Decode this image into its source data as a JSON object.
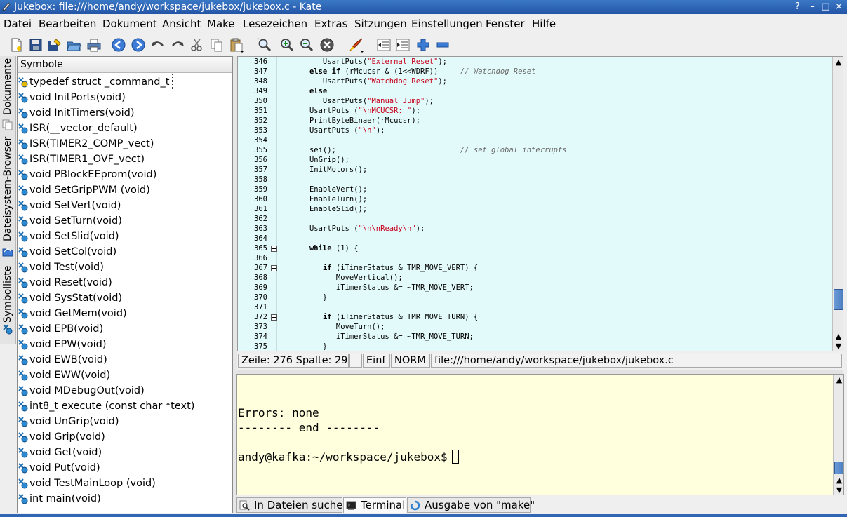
{
  "window": {
    "title": "Jukebox: file:///home/andy/workspace/jukebox/jukebox.c - Kate",
    "controls": {
      "help": "?",
      "minimize": "–",
      "maximize": "□",
      "close": "×"
    }
  },
  "menubar": [
    "Datei",
    "Bearbeiten",
    "Dokument",
    "Ansicht",
    "Make",
    "Lesezeichen",
    "Extras",
    "Sitzungen",
    "Einstellungen",
    "Fenster",
    "Hilfe"
  ],
  "toolbar_icons": [
    "new-file-icon",
    "save-icon",
    "save-as-icon",
    "open-icon",
    "print-icon",
    "back-icon",
    "forward-icon",
    "undo-icon",
    "redo-icon",
    "cut-icon",
    "copy-icon",
    "paste-icon",
    "find-icon",
    "zoom-in-icon",
    "zoom-out-icon",
    "stop-icon",
    "run-icon",
    "unindent-icon",
    "indent-icon",
    "expand-icon",
    "collapse-icon"
  ],
  "side_tabs": [
    "Dokumente",
    "Dateisystem-Browser",
    "Symbolliste"
  ],
  "symbols": {
    "header": "Symbole",
    "items": [
      "typedef struct _command_t",
      "void InitPorts(void)",
      "void InitTimers(void)",
      "ISR(__vector_default)",
      "ISR(TIMER2_COMP_vect)",
      "ISR(TIMER1_OVF_vect)",
      "void PBlockEEprom(void)",
      "void SetGripPWM (void)",
      "void SetVert(void)",
      "void SetTurn(void)",
      "void SetSlid(void)",
      "void SetCol(void)",
      "void Test(void)",
      "void Reset(void)",
      "void SysStat(void)",
      "void GetMem(void)",
      "void EPB(void)",
      "void EPW(void)",
      "void EWB(void)",
      "void EWW(void)",
      "void MDebugOut(void)",
      "int8_t execute (const char *text)",
      "void UnGrip(void)",
      "void Grip(void)",
      "void Get(void)",
      "void Put(void)",
      "void TestMainLoop (void)",
      "int main(void)"
    ]
  },
  "editor": {
    "lines": [
      {
        "n": "346",
        "fold": false,
        "parts": [
          [
            "      UsartPuts(",
            ""
          ],
          [
            "\"External Reset\"",
            "str"
          ],
          [
            ");",
            ""
          ]
        ]
      },
      {
        "n": "347",
        "fold": false,
        "parts": [
          [
            "   ",
            ""
          ],
          [
            "else if",
            "kw"
          ],
          [
            " (rMcucsr & (1<<WDRF))     ",
            ""
          ],
          [
            "// Watchdog Reset",
            "com"
          ]
        ]
      },
      {
        "n": "348",
        "fold": false,
        "parts": [
          [
            "      UsartPuts(",
            ""
          ],
          [
            "\"Watchdog Reset\"",
            "str"
          ],
          [
            ");",
            ""
          ]
        ]
      },
      {
        "n": "349",
        "fold": false,
        "parts": [
          [
            "   ",
            ""
          ],
          [
            "else",
            "kw"
          ]
        ]
      },
      {
        "n": "350",
        "fold": false,
        "parts": [
          [
            "      UsartPuts(",
            ""
          ],
          [
            "\"Manual Jump\"",
            "str"
          ],
          [
            ");",
            ""
          ]
        ]
      },
      {
        "n": "351",
        "fold": false,
        "parts": [
          [
            "   UsartPuts (",
            ""
          ],
          [
            "\"\\nMCUCSR: \"",
            "str"
          ],
          [
            ");",
            ""
          ]
        ]
      },
      {
        "n": "352",
        "fold": false,
        "parts": [
          [
            "   PrintByteBinaer(rMcucsr);",
            ""
          ]
        ]
      },
      {
        "n": "353",
        "fold": false,
        "parts": [
          [
            "   UsartPuts (",
            ""
          ],
          [
            "\"\\n\"",
            "str"
          ],
          [
            ");",
            ""
          ]
        ]
      },
      {
        "n": "354",
        "fold": false,
        "parts": [
          [
            "",
            ""
          ]
        ]
      },
      {
        "n": "355",
        "fold": false,
        "parts": [
          [
            "   sei();                            ",
            ""
          ],
          [
            "// set global interrupts",
            "com"
          ]
        ]
      },
      {
        "n": "356",
        "fold": false,
        "parts": [
          [
            "   UnGrip();",
            ""
          ]
        ]
      },
      {
        "n": "357",
        "fold": false,
        "parts": [
          [
            "   InitMotors();",
            ""
          ]
        ]
      },
      {
        "n": "358",
        "fold": false,
        "parts": [
          [
            "",
            ""
          ]
        ]
      },
      {
        "n": "359",
        "fold": false,
        "parts": [
          [
            "   EnableVert();",
            ""
          ]
        ]
      },
      {
        "n": "360",
        "fold": false,
        "parts": [
          [
            "   EnableTurn();",
            ""
          ]
        ]
      },
      {
        "n": "361",
        "fold": false,
        "parts": [
          [
            "   EnableSlid();",
            ""
          ]
        ]
      },
      {
        "n": "362",
        "fold": false,
        "parts": [
          [
            "",
            ""
          ]
        ]
      },
      {
        "n": "363",
        "fold": false,
        "parts": [
          [
            "   UsartPuts (",
            ""
          ],
          [
            "\"\\n\\nReady\\n\"",
            "str"
          ],
          [
            ");",
            ""
          ]
        ]
      },
      {
        "n": "364",
        "fold": false,
        "parts": [
          [
            "",
            ""
          ]
        ]
      },
      {
        "n": "365",
        "fold": true,
        "parts": [
          [
            "   ",
            ""
          ],
          [
            "while",
            "kw"
          ],
          [
            " (1) {",
            ""
          ]
        ]
      },
      {
        "n": "366",
        "fold": false,
        "parts": [
          [
            "",
            ""
          ]
        ]
      },
      {
        "n": "367",
        "fold": true,
        "parts": [
          [
            "      ",
            ""
          ],
          [
            "if",
            "kw"
          ],
          [
            " (iTimerStatus & TMR_MOVE_VERT) {",
            ""
          ]
        ]
      },
      {
        "n": "368",
        "fold": false,
        "parts": [
          [
            "         MoveVertical();",
            ""
          ]
        ]
      },
      {
        "n": "369",
        "fold": false,
        "parts": [
          [
            "         iTimerStatus &= ~TMR_MOVE_VERT;",
            ""
          ]
        ]
      },
      {
        "n": "370",
        "fold": false,
        "parts": [
          [
            "      }",
            ""
          ]
        ]
      },
      {
        "n": "371",
        "fold": false,
        "parts": [
          [
            "",
            ""
          ]
        ]
      },
      {
        "n": "372",
        "fold": true,
        "parts": [
          [
            "      ",
            ""
          ],
          [
            "if",
            "kw"
          ],
          [
            " (iTimerStatus & TMR_MOVE_TURN) {",
            ""
          ]
        ]
      },
      {
        "n": "373",
        "fold": false,
        "parts": [
          [
            "         MoveTurn();",
            ""
          ]
        ]
      },
      {
        "n": "374",
        "fold": false,
        "parts": [
          [
            "         iTimerStatus &= ~TMR_MOVE_TURN;",
            ""
          ]
        ]
      },
      {
        "n": "375",
        "fold": false,
        "parts": [
          [
            "      }",
            ""
          ]
        ]
      }
    ]
  },
  "statusbar": {
    "position": "Zeile: 276 Spalte: 29",
    "modified": "",
    "insert_mode": "Einf",
    "select_mode": "NORM",
    "file": "file:///home/andy/workspace/jukebox/jukebox.c"
  },
  "terminal": {
    "lines": [
      "Errors: none",
      "-------- end --------",
      "",
      "andy@kafka:~/workspace/jukebox$"
    ]
  },
  "bottom_tabs": [
    "In Dateien suchen",
    "Terminal",
    "Ausgabe von \"make\""
  ],
  "colors": {
    "editor_bg": "#e3fafa",
    "terminal_bg": "#ffffdd",
    "string": "#c8001c",
    "titlebar": "#2a5fae"
  }
}
